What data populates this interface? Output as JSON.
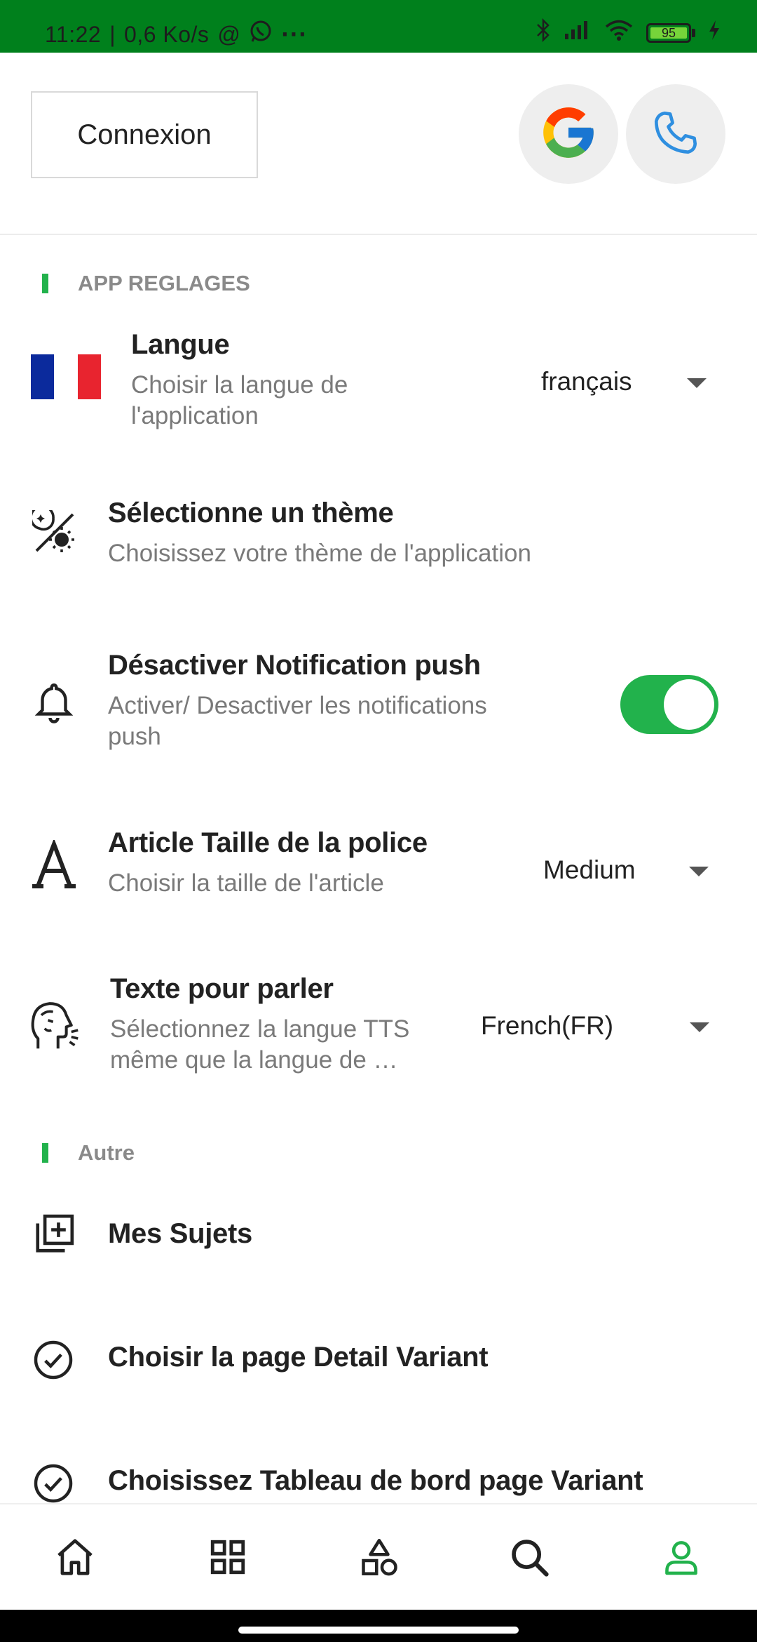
{
  "status_bar": {
    "time": "11:22",
    "net_speed": "0,6 Ko/s",
    "extra": "@",
    "dots": "···",
    "battery": "95",
    "icons": [
      "whatsapp-icon",
      "bluetooth-icon",
      "signal-icon",
      "wifi-icon",
      "battery-icon",
      "charging-icon"
    ]
  },
  "header": {
    "login_label": "Connexion",
    "google_icon": "google-icon",
    "phone_icon": "phone-icon"
  },
  "sections": {
    "app_settings": "APP REGLAGES",
    "other": "Autre"
  },
  "settings": {
    "language": {
      "title": "Langue",
      "subtitle_line1": "Choisir la langue de",
      "subtitle_line2": "l'application",
      "value": "français",
      "icon": "french-flag-icon"
    },
    "theme": {
      "title": "Sélectionne un thème",
      "subtitle": "Choisissez votre thème de l'application",
      "icon": "theme-icon"
    },
    "push": {
      "title": "Désactiver Notification push",
      "subtitle_line1": "Activer/ Desactiver les notifications",
      "subtitle_line2": "push",
      "enabled": true,
      "icon": "bell-icon"
    },
    "font_size": {
      "title": "Article Taille de la police",
      "subtitle": "Choisir la taille de l'article",
      "value": "Medium",
      "icon": "font-size-icon"
    },
    "tts": {
      "title": "Texte pour parler",
      "subtitle_line1": "Sélectionnez la langue TTS",
      "subtitle_line2": "même que la langue de …",
      "value": "French(FR)",
      "icon": "speaking-head-icon"
    }
  },
  "other_items": {
    "my_topics": "Mes Sujets",
    "detail_variant": "Choisir la page Detail Variant",
    "dashboard_variant": "Choisissez Tableau de bord page Variant"
  },
  "bottom_nav": {
    "items": [
      "home-icon",
      "grid-icon",
      "categories-icon",
      "search-icon",
      "profile-icon"
    ],
    "active": "profile-icon"
  },
  "colors": {
    "status_bar": "#00801c",
    "accent": "#22b24c",
    "phone_icon": "#2f8fe0"
  }
}
